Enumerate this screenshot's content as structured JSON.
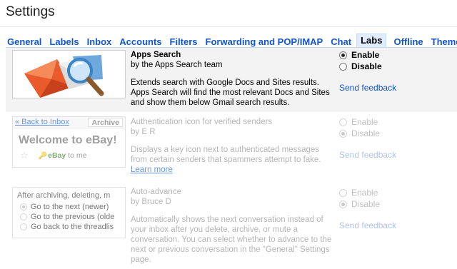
{
  "page": {
    "title": "Settings"
  },
  "tabs": [
    {
      "label": "General",
      "active": false
    },
    {
      "label": "Labels",
      "active": false
    },
    {
      "label": "Inbox",
      "active": false
    },
    {
      "label": "Accounts",
      "active": false
    },
    {
      "label": "Filters",
      "active": false
    },
    {
      "label": "Forwarding and POP/IMAP",
      "active": false
    },
    {
      "label": "Chat",
      "active": false
    },
    {
      "label": "Labs",
      "active": true
    },
    {
      "label": "Offline",
      "active": false
    },
    {
      "label": "Themes",
      "active": false
    }
  ],
  "labs": [
    {
      "name": "Apps Search",
      "author": "by the Apps Search team",
      "description": "Extends search with Google Docs and Sites results. Apps Search will find the most relevant Docs and Sites and show them below Gmail search results.",
      "enable_label": "Enable",
      "disable_label": "Disable",
      "selected": "Enable",
      "feedback": "Send feedback",
      "thumbnail": "envelope-magnifier-icon"
    },
    {
      "name": "Authentication icon for verified senders",
      "author": "by E R",
      "description": "Displays a key icon next to authenticated messages from certain senders that spammers attempt to fake.",
      "learn_more": "Learn more",
      "enable_label": "Enable",
      "disable_label": "Disable",
      "selected": "Disable",
      "feedback": "Send feedback",
      "thumbnail": {
        "back": "« Back to Inbox",
        "archive": "Archive",
        "welcome": "Welcome to eBay!",
        "sender": "eBay",
        "to": "to me"
      }
    },
    {
      "name": "Auto-advance",
      "author": "by Bruce D",
      "description": "Automatically shows the next conversation instead of your inbox after you delete, archive, or mute a conversation. You can select whether to advance to the next or previous conversation in the \"General\" Settings page.",
      "enable_label": "Enable",
      "disable_label": "Disable",
      "selected": "Disable",
      "feedback": "Send feedback",
      "thumbnail": {
        "title": "After archiving, deleting, m",
        "options": [
          "Go to the next (newer)",
          "Go to the previous (olde",
          "Go back to the threadlis"
        ],
        "selected_index": 0
      }
    }
  ],
  "colors": {
    "link": "#1155cc",
    "active_tab_bg": "#e0ecff",
    "tab_border": "#c3d9ff",
    "enabled_row_bg": "#f3f3f3"
  }
}
